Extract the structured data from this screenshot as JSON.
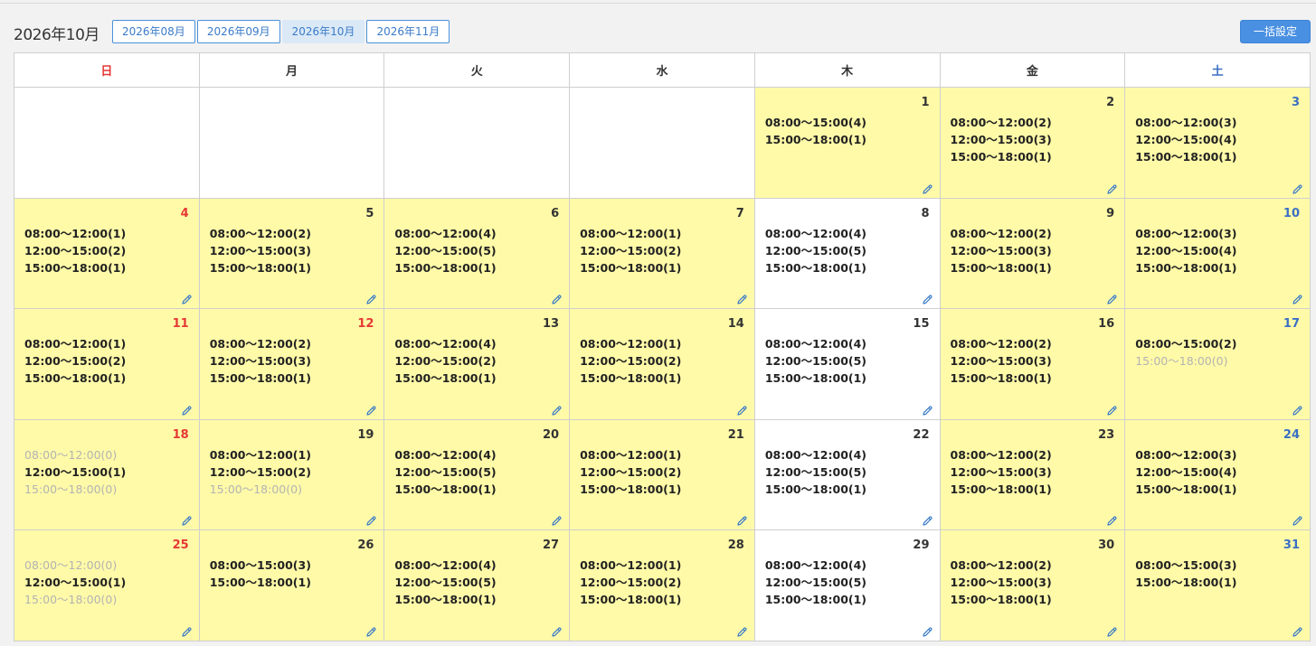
{
  "header": {
    "month_title": "2026年10月",
    "month_tabs": [
      {
        "label": "2026年08月",
        "active": false
      },
      {
        "label": "2026年09月",
        "active": false
      },
      {
        "label": "2026年10月",
        "active": true
      },
      {
        "label": "2026年11月",
        "active": false
      }
    ],
    "bulk_button_label": "一括設定"
  },
  "colors": {
    "highlight": "#fffaa8",
    "accent": "#4a90e2",
    "sunday": "#e53935",
    "saturday": "#3a6fc4"
  },
  "calendar": {
    "weekdays": [
      "日",
      "月",
      "火",
      "水",
      "木",
      "金",
      "土"
    ],
    "weeks": [
      [
        null,
        null,
        null,
        null,
        {
          "day": "1",
          "hl": true,
          "slots": [
            {
              "t": "08:00〜15:00(4)"
            },
            {
              "t": "15:00〜18:00(1)"
            }
          ]
        },
        {
          "day": "2",
          "hl": true,
          "slots": [
            {
              "t": "08:00〜12:00(2)"
            },
            {
              "t": "12:00〜15:00(3)"
            },
            {
              "t": "15:00〜18:00(1)"
            }
          ]
        },
        {
          "day": "3",
          "hl": true,
          "slots": [
            {
              "t": "08:00〜12:00(3)"
            },
            {
              "t": "12:00〜15:00(4)"
            },
            {
              "t": "15:00〜18:00(1)"
            }
          ]
        }
      ],
      [
        {
          "day": "4",
          "hl": true,
          "slots": [
            {
              "t": "08:00〜12:00(1)"
            },
            {
              "t": "12:00〜15:00(2)"
            },
            {
              "t": "15:00〜18:00(1)"
            }
          ]
        },
        {
          "day": "5",
          "hl": true,
          "slots": [
            {
              "t": "08:00〜12:00(2)"
            },
            {
              "t": "12:00〜15:00(3)"
            },
            {
              "t": "15:00〜18:00(1)"
            }
          ]
        },
        {
          "day": "6",
          "hl": true,
          "slots": [
            {
              "t": "08:00〜12:00(4)"
            },
            {
              "t": "12:00〜15:00(5)"
            },
            {
              "t": "15:00〜18:00(1)"
            }
          ]
        },
        {
          "day": "7",
          "hl": true,
          "slots": [
            {
              "t": "08:00〜12:00(1)"
            },
            {
              "t": "12:00〜15:00(2)"
            },
            {
              "t": "15:00〜18:00(1)"
            }
          ]
        },
        {
          "day": "8",
          "hl": false,
          "slots": [
            {
              "t": "08:00〜12:00(4)"
            },
            {
              "t": "12:00〜15:00(5)"
            },
            {
              "t": "15:00〜18:00(1)"
            }
          ]
        },
        {
          "day": "9",
          "hl": true,
          "slots": [
            {
              "t": "08:00〜12:00(2)"
            },
            {
              "t": "12:00〜15:00(3)"
            },
            {
              "t": "15:00〜18:00(1)"
            }
          ]
        },
        {
          "day": "10",
          "hl": true,
          "slots": [
            {
              "t": "08:00〜12:00(3)"
            },
            {
              "t": "12:00〜15:00(4)"
            },
            {
              "t": "15:00〜18:00(1)"
            }
          ]
        }
      ],
      [
        {
          "day": "11",
          "hl": true,
          "slots": [
            {
              "t": "08:00〜12:00(1)"
            },
            {
              "t": "12:00〜15:00(2)"
            },
            {
              "t": "15:00〜18:00(1)"
            }
          ]
        },
        {
          "day": "12",
          "hl": true,
          "holiday": true,
          "slots": [
            {
              "t": "08:00〜12:00(2)"
            },
            {
              "t": "12:00〜15:00(3)"
            },
            {
              "t": "15:00〜18:00(1)"
            }
          ]
        },
        {
          "day": "13",
          "hl": true,
          "slots": [
            {
              "t": "08:00〜12:00(4)"
            },
            {
              "t": "12:00〜15:00(2)"
            },
            {
              "t": "15:00〜18:00(1)"
            }
          ]
        },
        {
          "day": "14",
          "hl": true,
          "slots": [
            {
              "t": "08:00〜12:00(1)"
            },
            {
              "t": "12:00〜15:00(2)"
            },
            {
              "t": "15:00〜18:00(1)"
            }
          ]
        },
        {
          "day": "15",
          "hl": false,
          "slots": [
            {
              "t": "08:00〜12:00(4)"
            },
            {
              "t": "12:00〜15:00(5)"
            },
            {
              "t": "15:00〜18:00(1)"
            }
          ]
        },
        {
          "day": "16",
          "hl": true,
          "slots": [
            {
              "t": "08:00〜12:00(2)"
            },
            {
              "t": "12:00〜15:00(3)"
            },
            {
              "t": "15:00〜18:00(1)"
            }
          ]
        },
        {
          "day": "17",
          "hl": true,
          "slots": [
            {
              "t": "08:00〜15:00(2)"
            },
            {
              "t": "15:00〜18:00(0)",
              "empty": true
            }
          ]
        }
      ],
      [
        {
          "day": "18",
          "hl": true,
          "slots": [
            {
              "t": "08:00〜12:00(0)",
              "empty": true
            },
            {
              "t": "12:00〜15:00(1)"
            },
            {
              "t": "15:00〜18:00(0)",
              "empty": true
            }
          ]
        },
        {
          "day": "19",
          "hl": true,
          "slots": [
            {
              "t": "08:00〜12:00(1)"
            },
            {
              "t": "12:00〜15:00(2)"
            },
            {
              "t": "15:00〜18:00(0)",
              "empty": true
            }
          ]
        },
        {
          "day": "20",
          "hl": true,
          "slots": [
            {
              "t": "08:00〜12:00(4)"
            },
            {
              "t": "12:00〜15:00(5)"
            },
            {
              "t": "15:00〜18:00(1)"
            }
          ]
        },
        {
          "day": "21",
          "hl": true,
          "slots": [
            {
              "t": "08:00〜12:00(1)"
            },
            {
              "t": "12:00〜15:00(2)"
            },
            {
              "t": "15:00〜18:00(1)"
            }
          ]
        },
        {
          "day": "22",
          "hl": false,
          "slots": [
            {
              "t": "08:00〜12:00(4)"
            },
            {
              "t": "12:00〜15:00(5)"
            },
            {
              "t": "15:00〜18:00(1)"
            }
          ]
        },
        {
          "day": "23",
          "hl": true,
          "slots": [
            {
              "t": "08:00〜12:00(2)"
            },
            {
              "t": "12:00〜15:00(3)"
            },
            {
              "t": "15:00〜18:00(1)"
            }
          ]
        },
        {
          "day": "24",
          "hl": true,
          "slots": [
            {
              "t": "08:00〜12:00(3)"
            },
            {
              "t": "12:00〜15:00(4)"
            },
            {
              "t": "15:00〜18:00(1)"
            }
          ]
        }
      ],
      [
        {
          "day": "25",
          "hl": true,
          "slots": [
            {
              "t": "08:00〜12:00(0)",
              "empty": true
            },
            {
              "t": "12:00〜15:00(1)"
            },
            {
              "t": "15:00〜18:00(0)",
              "empty": true
            }
          ]
        },
        {
          "day": "26",
          "hl": true,
          "slots": [
            {
              "t": "08:00〜15:00(3)"
            },
            {
              "t": "15:00〜18:00(1)"
            }
          ]
        },
        {
          "day": "27",
          "hl": true,
          "slots": [
            {
              "t": "08:00〜12:00(4)"
            },
            {
              "t": "12:00〜15:00(5)"
            },
            {
              "t": "15:00〜18:00(1)"
            }
          ]
        },
        {
          "day": "28",
          "hl": true,
          "slots": [
            {
              "t": "08:00〜12:00(1)"
            },
            {
              "t": "12:00〜15:00(2)"
            },
            {
              "t": "15:00〜18:00(1)"
            }
          ]
        },
        {
          "day": "29",
          "hl": false,
          "slots": [
            {
              "t": "08:00〜12:00(4)"
            },
            {
              "t": "12:00〜15:00(5)"
            },
            {
              "t": "15:00〜18:00(1)"
            }
          ]
        },
        {
          "day": "30",
          "hl": true,
          "slots": [
            {
              "t": "08:00〜12:00(2)"
            },
            {
              "t": "12:00〜15:00(3)"
            },
            {
              "t": "15:00〜18:00(1)"
            }
          ]
        },
        {
          "day": "31",
          "hl": true,
          "slots": [
            {
              "t": "08:00〜15:00(3)"
            },
            {
              "t": "15:00〜18:00(1)"
            }
          ]
        }
      ]
    ]
  }
}
